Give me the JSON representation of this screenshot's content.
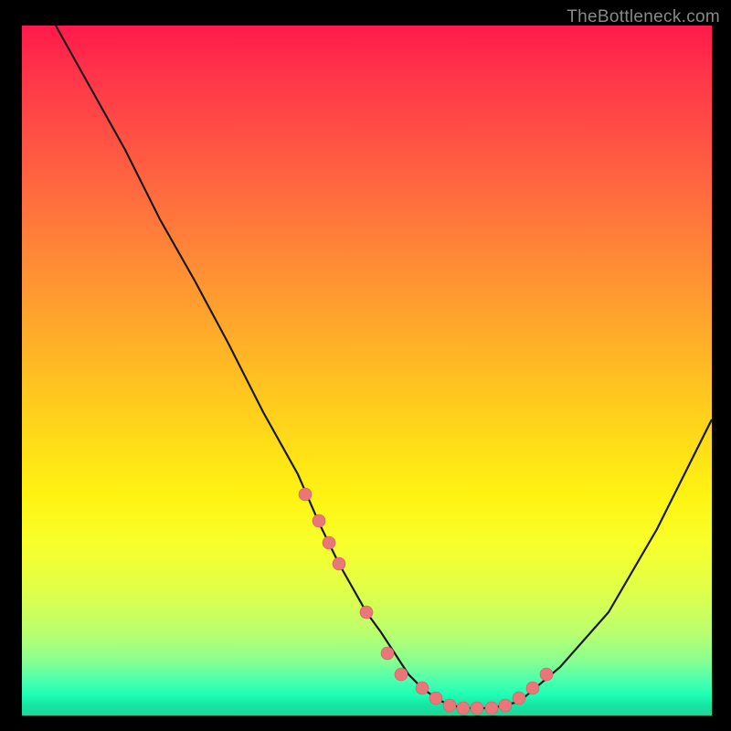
{
  "watermark": "TheBottleneck.com",
  "chart_data": {
    "type": "line",
    "title": "",
    "xlabel": "",
    "ylabel": "",
    "xlim": [
      0,
      100
    ],
    "ylim": [
      0,
      100
    ],
    "grid": false,
    "legend": false,
    "series": [
      {
        "name": "curve",
        "x": [
          5,
          10,
          15,
          20,
          25,
          30,
          35,
          40,
          43,
          46,
          50,
          52,
          54,
          56,
          58,
          60,
          62,
          65,
          68,
          72,
          78,
          85,
          92,
          100
        ],
        "y": [
          100,
          91,
          82,
          72,
          63,
          54,
          44,
          35,
          28,
          22,
          15,
          12,
          9,
          6,
          4,
          2.5,
          1.5,
          1,
          1,
          2,
          7,
          15,
          27,
          43
        ]
      },
      {
        "name": "markers",
        "x": [
          41,
          43,
          44.5,
          46,
          50,
          53,
          55,
          58,
          60,
          62,
          64,
          66,
          68,
          70,
          72,
          74,
          76
        ],
        "y": [
          32,
          28,
          25,
          22,
          15,
          9,
          6,
          4,
          2.5,
          1.5,
          1,
          1,
          1,
          1.5,
          2.5,
          4,
          6
        ]
      }
    ],
    "gradient_colors": {
      "top": "#ff1a4b",
      "middle": "#ffd51a",
      "bottom": "#1dd69a"
    },
    "marker_color": "#e97679",
    "curve_color": "#1a1a1a"
  }
}
